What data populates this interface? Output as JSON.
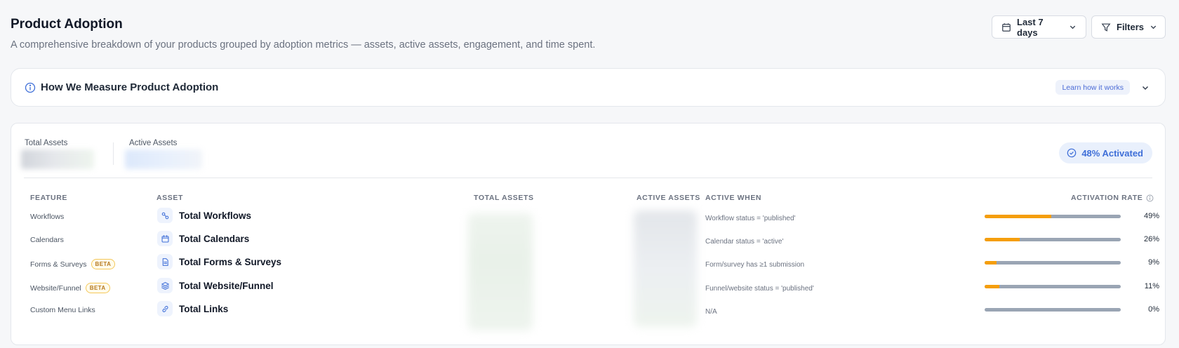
{
  "header": {
    "title": "Product Adoption",
    "subtitle": "A comprehensive breakdown of your products grouped by adoption metrics — assets, active assets, engagement, and time spent.",
    "date_range": "Last 7 days",
    "filters_label": "Filters"
  },
  "info": {
    "title": "How We Measure Product Adoption",
    "learn_label": "Learn how it works"
  },
  "summary": {
    "total_assets_label": "Total Assets",
    "active_assets_label": "Active Assets",
    "activated_badge": "48% Activated"
  },
  "table": {
    "headers": {
      "feature": "FEATURE",
      "asset": "ASSET",
      "total_assets": "TOTAL ASSETS",
      "active_assets": "ACTIVE ASSETS",
      "active_when": "ACTIVE WHEN",
      "activation_rate": "ACTIVATION RATE"
    },
    "beta_label": "BETA",
    "rows": [
      {
        "feature": "Workflows",
        "beta": false,
        "icon": "workflow-icon",
        "asset": "Total Workflows",
        "active_when": "Workflow status = 'published'",
        "rate": "49%",
        "rate_value": 0.49
      },
      {
        "feature": "Calendars",
        "beta": false,
        "icon": "calendar-icon",
        "asset": "Total Calendars",
        "active_when": "Calendar status = 'active'",
        "rate": "26%",
        "rate_value": 0.26
      },
      {
        "feature": "Forms & Surveys",
        "beta": true,
        "icon": "document-icon",
        "asset": "Total Forms & Surveys",
        "active_when": "Form/survey has ≥1 submission",
        "rate": "9%",
        "rate_value": 0.09
      },
      {
        "feature": "Website/Funnel",
        "beta": true,
        "icon": "layers-icon",
        "asset": "Total Website/Funnel",
        "active_when": "Funnel/website status = 'published'",
        "rate": "11%",
        "rate_value": 0.11
      },
      {
        "feature": "Custom Menu Links",
        "beta": false,
        "icon": "link-icon",
        "asset": "Total Links",
        "active_when": "N/A",
        "rate": "0%",
        "rate_value": 0.0
      }
    ]
  },
  "colors": {
    "accent": "#3f6fd8",
    "bar_fill": "#f59e0b",
    "bar_track": "#9aa5b4",
    "beta_border": "#f4c85a"
  }
}
